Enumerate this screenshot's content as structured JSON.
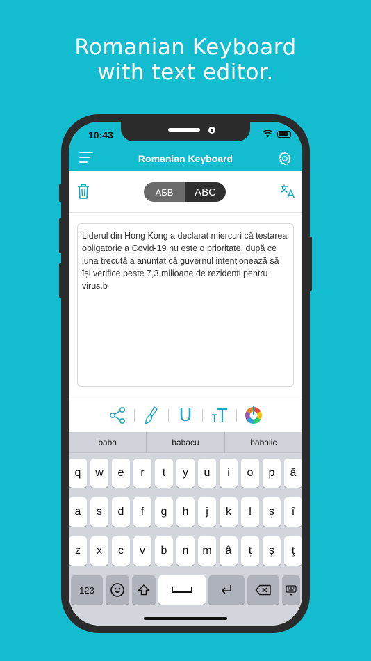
{
  "headline": {
    "line1": "Romanian Keyboard",
    "line2": "with text editor."
  },
  "status": {
    "time": "10:43"
  },
  "nav": {
    "title": "Romanian Keyboard"
  },
  "toolbar": {
    "segments": [
      {
        "label": "АБВ",
        "selected": false
      },
      {
        "label": "ABC",
        "selected": true
      }
    ]
  },
  "editor": {
    "text": "Liderul din Hong Kong a declarat miercuri că testarea obligatorie a Covid-19 nu este o prioritate, după ce luna trecută a anunțat că guvernul intenționează să își verifice peste 7,3 milioane de rezidenți pentru virus.b"
  },
  "actions": [
    "share-icon",
    "brush-icon",
    "underline-icon",
    "text-size-icon",
    "color-palette-icon"
  ],
  "actions_text": {
    "underline": "U"
  },
  "keyboard": {
    "suggestions": [
      "baba",
      "babacu",
      "babalic"
    ],
    "row1": [
      "q",
      "w",
      "e",
      "r",
      "t",
      "y",
      "u",
      "i",
      "o",
      "p",
      "ă"
    ],
    "row2": [
      "a",
      "s",
      "d",
      "f",
      "g",
      "h",
      "j",
      "k",
      "l",
      "ș",
      "î"
    ],
    "row3": [
      "z",
      "x",
      "c",
      "v",
      "b",
      "n",
      "m",
      "â",
      "ț",
      "ş",
      "ţ"
    ],
    "numbers_label": "123"
  },
  "colors": {
    "accent": "#14bccf",
    "icon": "#1aa8c4",
    "segment_selected": "#2f2f2f",
    "segment_unselected": "#6b6b6b"
  }
}
